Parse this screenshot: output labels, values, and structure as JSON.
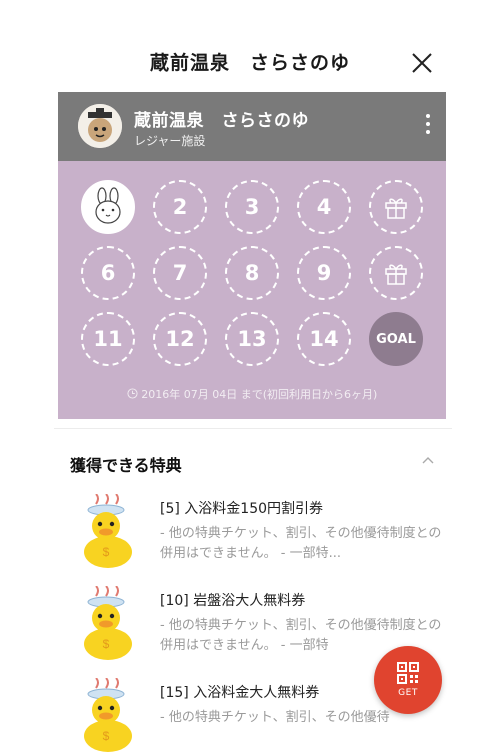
{
  "topbar": {
    "title": "蔵前温泉　さらさのゆ"
  },
  "card": {
    "title": "蔵前温泉　さらさのゆ",
    "subtitle": "レジャー施設",
    "expiry": "2016年 07月 04日 まで(初回利用日から6ヶ月)",
    "stamps": [
      {
        "label": "",
        "kind": "filled"
      },
      {
        "label": "2",
        "kind": "empty"
      },
      {
        "label": "3",
        "kind": "empty"
      },
      {
        "label": "4",
        "kind": "empty"
      },
      {
        "label": "",
        "kind": "gift"
      },
      {
        "label": "6",
        "kind": "empty"
      },
      {
        "label": "7",
        "kind": "empty"
      },
      {
        "label": "8",
        "kind": "empty"
      },
      {
        "label": "9",
        "kind": "empty"
      },
      {
        "label": "",
        "kind": "gift"
      },
      {
        "label": "11",
        "kind": "empty"
      },
      {
        "label": "12",
        "kind": "empty"
      },
      {
        "label": "13",
        "kind": "empty"
      },
      {
        "label": "14",
        "kind": "empty"
      },
      {
        "label": "GOAL",
        "kind": "goal"
      }
    ]
  },
  "rewards": {
    "title": "獲得できる特典",
    "items": [
      {
        "title": "[5] 入浴料金150円割引券",
        "desc": "- 他の特典チケット、割引、その他優待制度との併用はできません。 - 一部特..."
      },
      {
        "title": "[10] 岩盤浴大人無料券",
        "desc": "- 他の特典チケット、割引、その他優待制度との併用はできません。 - 一部特"
      },
      {
        "title": "[15] 入浴料金大人無料券",
        "desc": "- 他の特典チケット、割引、その他優待"
      }
    ]
  },
  "get_button": {
    "label": "GET"
  },
  "colors": {
    "card_bg": "#c8b1ca",
    "header_bg": "#7a7a7a",
    "goal_bg": "#8e7c8f",
    "get_bg": "#e0442f"
  }
}
